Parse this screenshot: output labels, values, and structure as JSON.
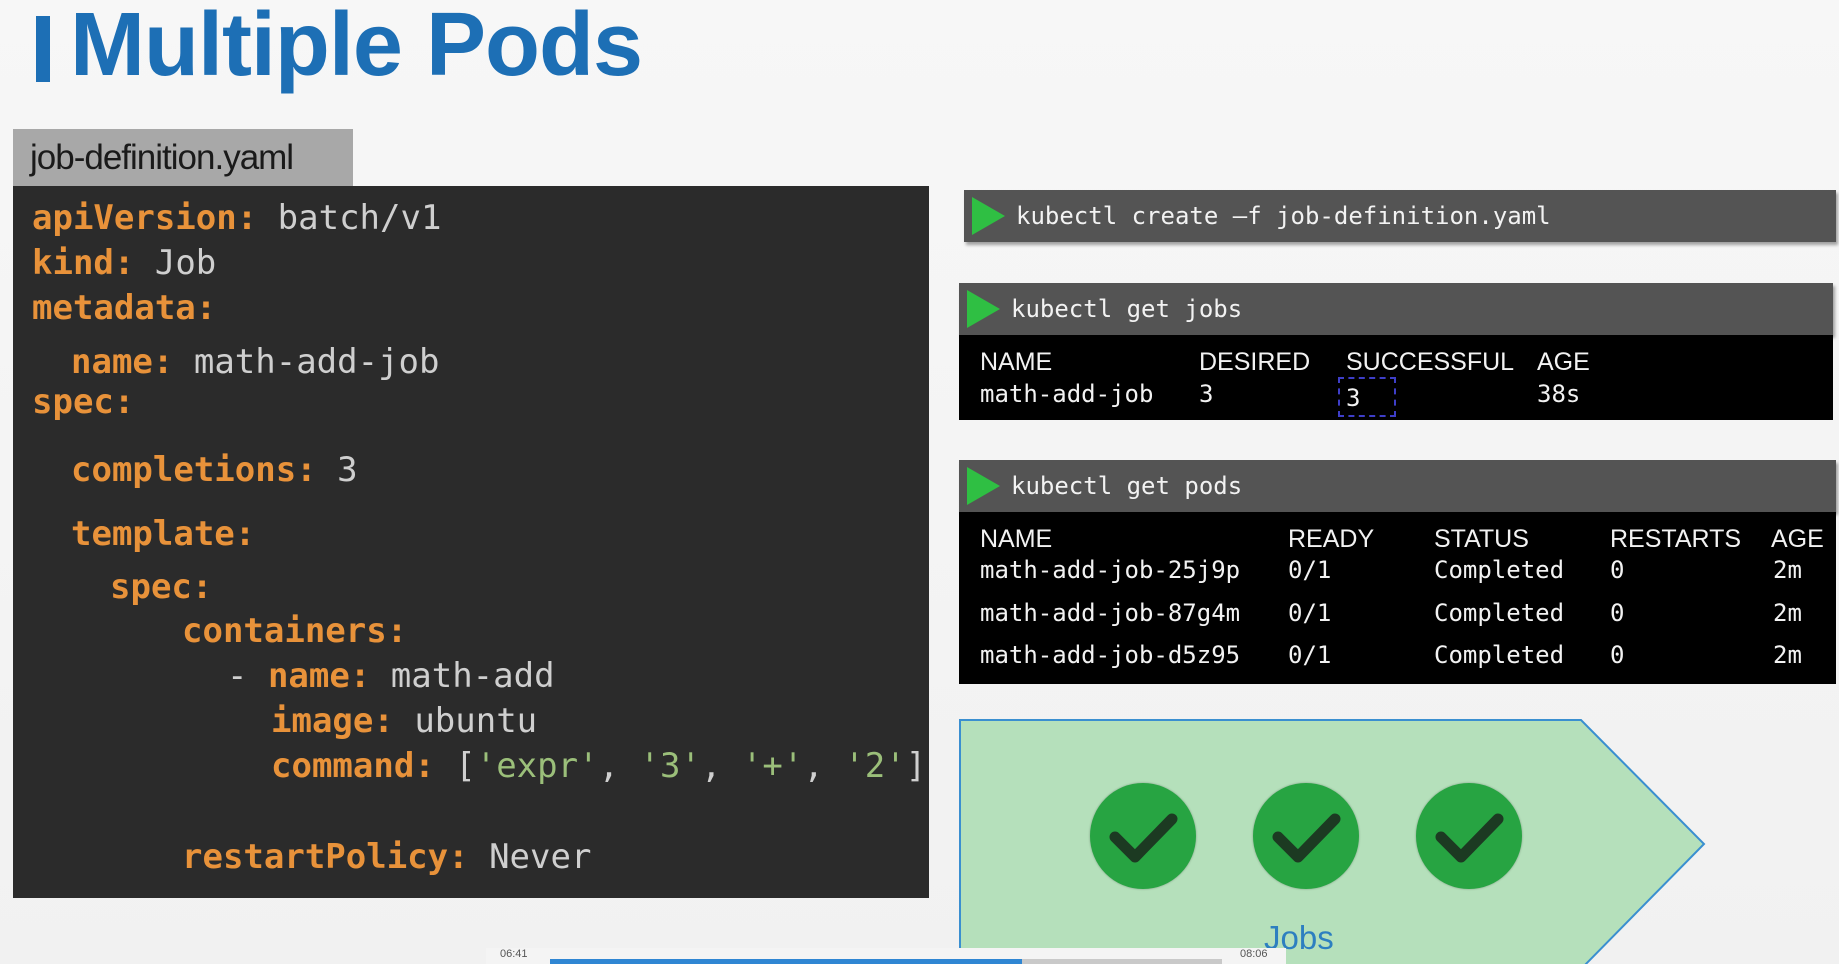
{
  "slide": {
    "title": "Multiple Pods",
    "accent_color": "#1d6fb5"
  },
  "file_tab": {
    "label": "job-definition.yaml"
  },
  "yaml": {
    "apiVersion_key": "apiVersion:",
    "apiVersion_value": "batch/v1",
    "kind_key": "kind:",
    "kind_value": "Job",
    "metadata_key": "metadata:",
    "name_key": "name:",
    "name_value": "math-add-job",
    "spec_key": "spec:",
    "completions_key": "completions:",
    "completions_value": "3",
    "template_key": "template:",
    "inner_spec_key": "spec:",
    "containers_key": "containers:",
    "dash": "- ",
    "container_name_key": "name:",
    "container_name_value": "math-add",
    "image_key": "image:",
    "image_value": "ubuntu",
    "command_key": "command:",
    "command_open": "[",
    "command_args": [
      "'expr'",
      ", ",
      "'3'",
      ", ",
      "'+'",
      ", ",
      "'2'"
    ],
    "command_close": "]",
    "restart_key": "restartPolicy:",
    "restart_value": "Never"
  },
  "commands": {
    "create": "kubectl create –f job-definition.yaml",
    "get_jobs": "kubectl get jobs",
    "get_pods": "kubectl get pods"
  },
  "jobs_table": {
    "headers": [
      "NAME",
      "DESIRED",
      "SUCCESSFUL",
      "AGE"
    ],
    "rows": [
      [
        "math-add-job",
        "3",
        "3",
        "38s"
      ]
    ]
  },
  "pods_table": {
    "headers": [
      "NAME",
      "READY",
      "STATUS",
      "RESTARTS",
      "AGE"
    ],
    "rows": [
      [
        "math-add-job-25j9p",
        "0/1",
        "Completed",
        "0",
        "2m"
      ],
      [
        "math-add-job-87g4m",
        "0/1",
        "Completed",
        "0",
        "2m"
      ],
      [
        "math-add-job-d5z95",
        "0/1",
        "Completed",
        "0",
        "2m"
      ]
    ]
  },
  "diagram": {
    "label": "Jobs",
    "checks": [
      "check-icon",
      "check-icon",
      "check-icon"
    ],
    "fill_color": "#b5e0bb",
    "border_color": "#3a8fd0"
  },
  "video": {
    "elapsed": "06:41",
    "total": "08:06",
    "progress": 0.703
  }
}
